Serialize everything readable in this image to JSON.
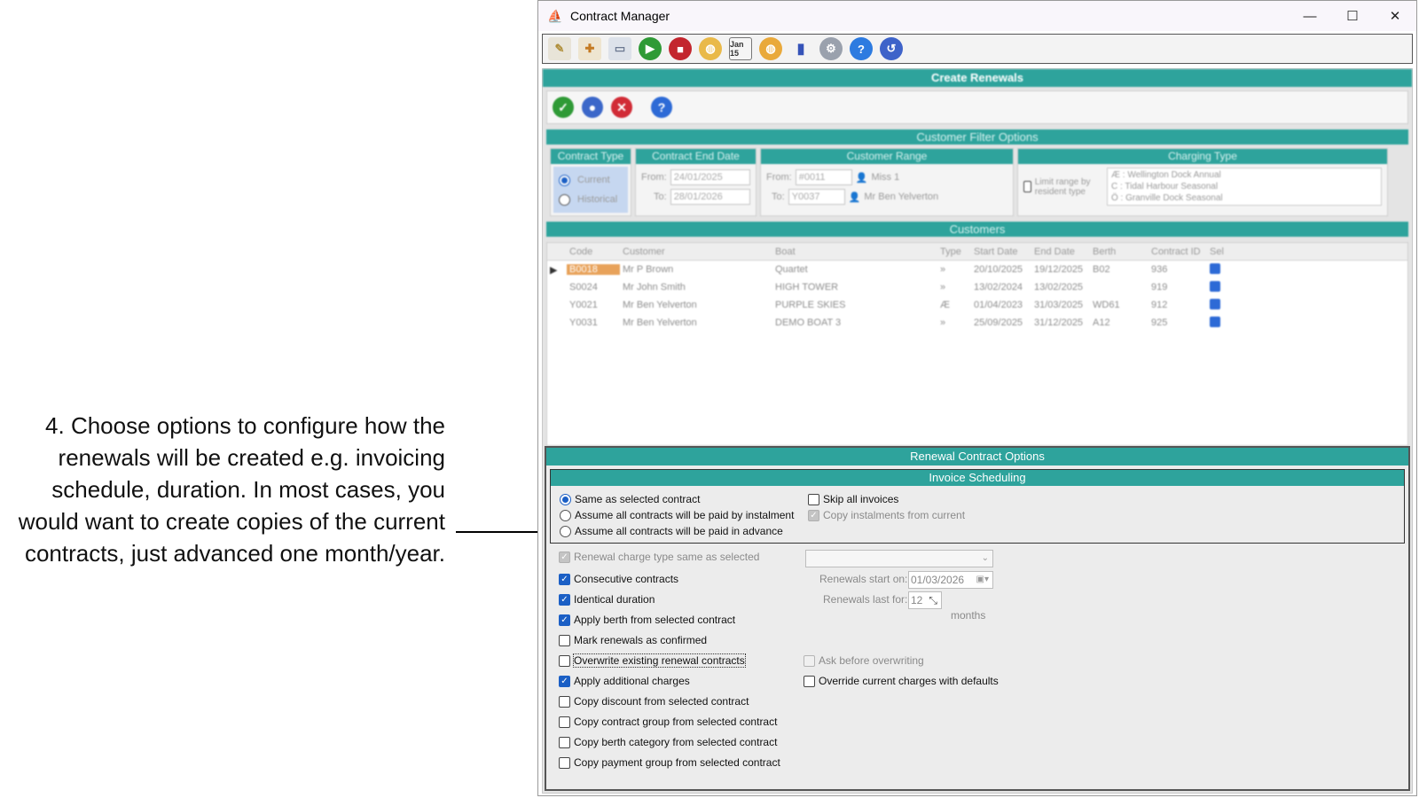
{
  "annotation": {
    "text": "4. Choose options to configure how the renewals will be created e.g. invoicing schedule, duration. In most cases, you would want to create copies of the current contracts, just advanced one month/year."
  },
  "window": {
    "title": "Contract Manager",
    "controls": {
      "minimize": "—",
      "maximize": "☐",
      "close": "✕"
    }
  },
  "toolbar": {
    "icons": [
      "edit-icon",
      "add-user-icon",
      "scanner-icon",
      "play-icon",
      "stop-icon",
      "globe-icon",
      "calendar-add-icon",
      "globe-icon",
      "bar-chart-icon",
      "settings-icon",
      "help-icon",
      "back-icon"
    ],
    "calendar_label": "Jan 15"
  },
  "create_renewals": {
    "title": "Create Renewals",
    "actions": [
      "ok-icon",
      "user-icon",
      "cancel-icon",
      "help-icon"
    ]
  },
  "customer_filter": {
    "title": "Customer Filter Options",
    "contract_type": {
      "title": "Contract Type",
      "current": "Current",
      "historical": "Historical"
    },
    "contract_end_date": {
      "title": "Contract End Date",
      "from_label": "From:",
      "from": "24/01/2025",
      "to_label": "To:",
      "to": "28/01/2026"
    },
    "customer_range": {
      "title": "Customer Range",
      "from_label": "From:",
      "from_code": "#0011",
      "from_name": "Miss 1",
      "to_label": "To:",
      "to_code": "Y0037",
      "to_name": "Mr Ben Yelverton"
    },
    "charging_type": {
      "title": "Charging Type",
      "limit_label": "Limit range by resident type",
      "items": [
        "Æ : Wellington Dock Annual",
        "C : Tidal Harbour Seasonal",
        "Ö : Granville Dock Seasonal"
      ]
    }
  },
  "customers": {
    "title": "Customers",
    "columns": [
      "Code",
      "Customer",
      "Boat",
      "Type",
      "Start Date",
      "End Date",
      "Berth",
      "Contract ID",
      "Sel"
    ],
    "rows": [
      [
        "B0018",
        "Mr P Brown",
        "Quartet",
        "»",
        "20/10/2025",
        "19/12/2025",
        "B02",
        "936"
      ],
      [
        "S0024",
        "Mr John Smith",
        "HIGH TOWER",
        "»",
        "13/02/2024",
        "13/02/2025",
        "",
        "919"
      ],
      [
        "Y0021",
        "Mr Ben Yelverton",
        "PURPLE SKIES",
        "Æ",
        "01/04/2023",
        "31/03/2025",
        "WD61",
        "912"
      ],
      [
        "Y0031",
        "Mr Ben Yelverton",
        "DEMO BOAT 3",
        "»",
        "25/09/2025",
        "31/12/2025",
        "A12",
        "925"
      ]
    ]
  },
  "renewal_options": {
    "title": "Renewal Contract Options",
    "invoice_scheduling": {
      "title": "Invoice Scheduling",
      "same_as_selected": "Same as selected contract",
      "instalment": "Assume all contracts will be paid by instalment",
      "advance": "Assume all contracts will be paid in advance",
      "skip_all": "Skip all invoices",
      "copy_instalments": "Copy instalments from current"
    },
    "charge_type_same": "Renewal charge type same as selected",
    "consecutive": "Consecutive contracts",
    "identical_duration": "Identical duration",
    "apply_berth": "Apply berth from selected contract",
    "mark_confirmed": "Mark renewals as confirmed",
    "overwrite_existing": "Overwrite existing renewal contracts",
    "ask_before": "Ask before overwriting",
    "apply_additional": "Apply additional charges",
    "override_charges": "Override current charges with defaults",
    "copy_discount": "Copy discount from selected contract",
    "copy_group": "Copy contract group from selected contract",
    "copy_berth_category": "Copy berth category from selected contract",
    "copy_payment_group": "Copy payment group from selected contract",
    "renewals_start_label": "Renewals start on:",
    "renewals_start": "01/03/2026",
    "renewals_last_label": "Renewals last for:",
    "renewals_last": "12",
    "months": "months"
  },
  "colors": {
    "teal_header": "#2ea39c",
    "checkbox_blue": "#1b5fc5"
  }
}
